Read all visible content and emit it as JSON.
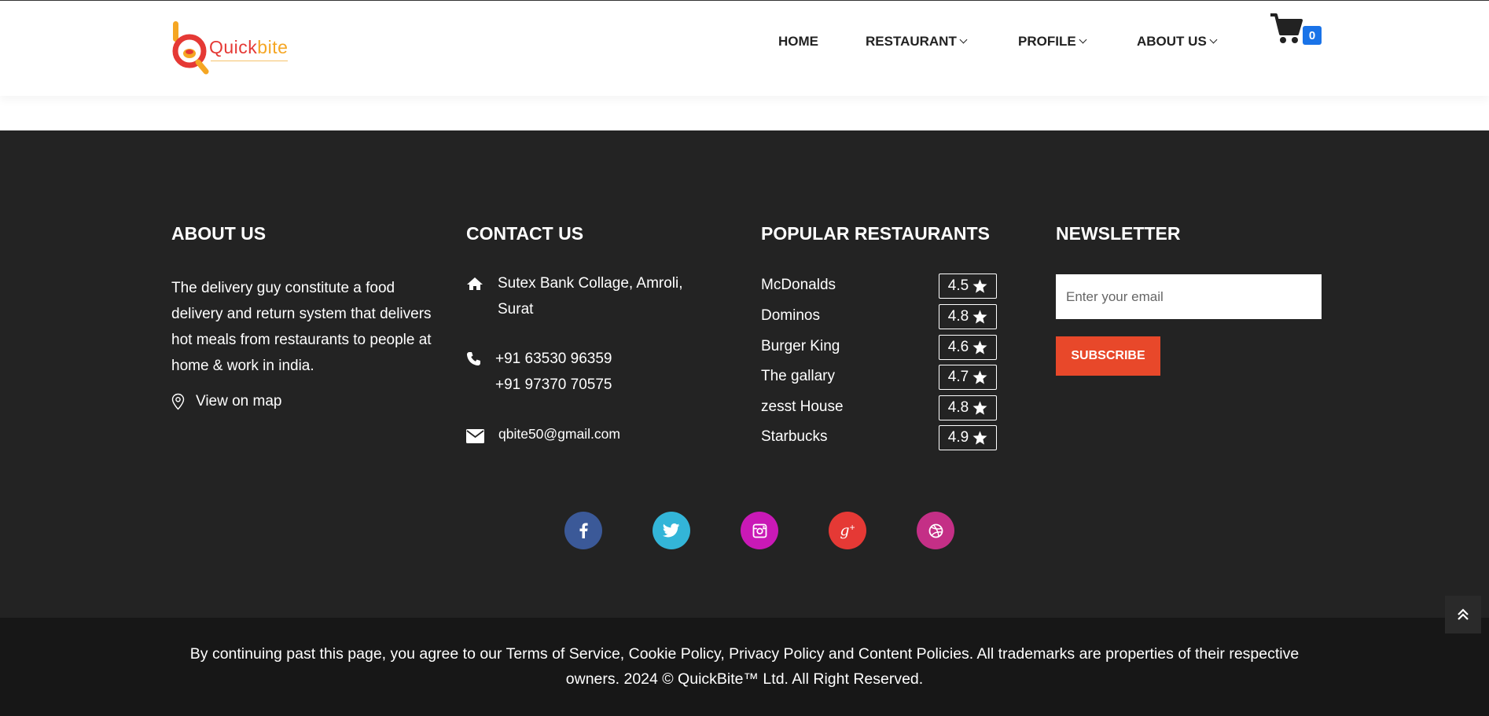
{
  "header": {
    "logo": {
      "text_main": "Quick",
      "text_accent": "bite",
      "alt": "Quickbite logo"
    },
    "nav": [
      {
        "label": "HOME",
        "has_dropdown": false
      },
      {
        "label": "RESTAURANT",
        "has_dropdown": true
      },
      {
        "label": "PROFILE",
        "has_dropdown": true
      },
      {
        "label": "ABOUT US",
        "has_dropdown": true
      }
    ],
    "cart": {
      "icon": "cart-icon",
      "count": "0"
    }
  },
  "footer": {
    "about": {
      "title": "ABOUT US",
      "text": "The delivery guy constitute a food delivery and return system that delivers hot meals from restaurants to people at home & work in india.",
      "map_link": "View on map",
      "map_icon": "map-pin-icon"
    },
    "contact": {
      "title": "CONTACT US",
      "address_line1": "Sutex Bank Collage, Amroli,",
      "address_line2": "Surat",
      "phone1": "+91 63530 96359",
      "phone2": "+91 97370 70575",
      "email": "qbite50@gmail.com"
    },
    "popular": {
      "title": "POPULAR RESTAURANTS",
      "restaurants": [
        {
          "name": "McDonalds",
          "rating": "4.5"
        },
        {
          "name": "Dominos",
          "rating": "4.8"
        },
        {
          "name": "Burger King",
          "rating": "4.6"
        },
        {
          "name": "The gallary",
          "rating": "4.7"
        },
        {
          "name": "zesst House",
          "rating": "4.8"
        },
        {
          "name": "Starbucks",
          "rating": "4.9"
        }
      ]
    },
    "newsletter": {
      "title": "NEWSLETTER",
      "placeholder": "Enter your email",
      "button": "SUBSCRIBE"
    },
    "social": [
      {
        "name": "facebook-icon",
        "color": "#3b5998"
      },
      {
        "name": "twitter-icon",
        "color": "#33b5d8"
      },
      {
        "name": "instagram-icon",
        "color": "#c919b6"
      },
      {
        "name": "google-plus-icon",
        "color": "#e53935"
      },
      {
        "name": "dribbble-icon",
        "color": "#c42f86"
      }
    ]
  },
  "bottom": {
    "text": "By continuing past this page, you agree to our Terms of Service, Cookie Policy, Privacy Policy and Content Policies. All trademarks are properties of their respective owners. 2024 © QuickBite™ Ltd. All Right Reserved."
  },
  "colors": {
    "accent": "#e8482a",
    "cart_badge": "#1a73e8",
    "footer_bg": "#232323",
    "bottom_bg": "#171717"
  }
}
